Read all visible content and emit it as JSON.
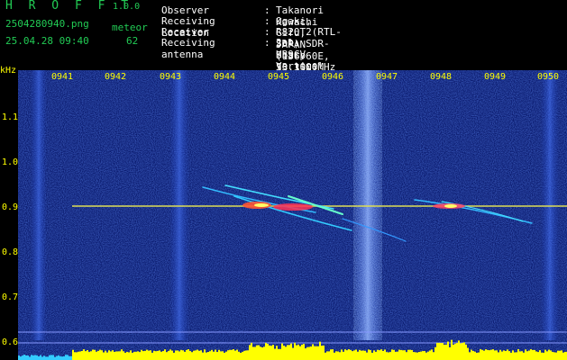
{
  "header": {
    "brand": "H R O F F T",
    "version": "1.0.0",
    "filename": "2504280940.png",
    "meteor_label": "meteor",
    "datetime": "25.04.28 09:40",
    "meteor_count": "62"
  },
  "info": [
    {
      "key": "Observer",
      "sep": ":",
      "value": "Takanori Kawachi"
    },
    {
      "key": "Receiving Location",
      "sep": ":",
      "value": "Ogaki, Gifu, JAPAN (136.60E, 35.35N)"
    },
    {
      "key": "Receiver",
      "sep": ":",
      "value": "R820T2(RTL-SDR) SDR-Sharp 53.1000MHz"
    },
    {
      "key": "Receiving antenna",
      "sep": ":",
      "value": "2el-HB9CV Vertical (el. E-W)"
    }
  ],
  "axis": {
    "unit": "kHz",
    "freq_labels": [
      "1.1",
      "1.0",
      "0.9",
      "0.8",
      "0.7",
      "0.6"
    ],
    "time_labels": [
      "0941",
      "0942",
      "0943",
      "0944",
      "0945",
      "0946",
      "0947",
      "0948",
      "0949",
      "0950"
    ]
  },
  "colors": {
    "header_green": "#22cc55",
    "text_white": "#ffffff",
    "axis_yellow": "#ffff00",
    "background_blue": "#0a1a6e",
    "carrier": "#dddd55",
    "audio_bars": "#ffff00"
  }
}
